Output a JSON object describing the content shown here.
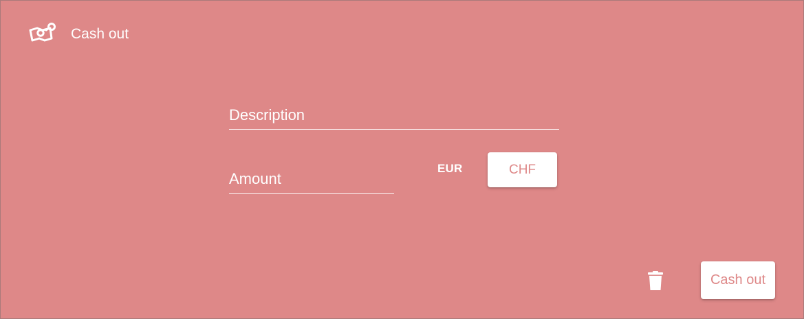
{
  "header": {
    "title": "Cash out",
    "icon": "money-transfer-icon"
  },
  "form": {
    "description_placeholder": "Description",
    "amount_placeholder": "Amount",
    "currency_label": "EUR",
    "currency_toggle_label": "CHF"
  },
  "actions": {
    "delete_icon": "trash-icon",
    "submit_label": "Cash out"
  },
  "colors": {
    "background": "#de8888",
    "button_background": "#ffffff",
    "button_text": "#de8888"
  }
}
